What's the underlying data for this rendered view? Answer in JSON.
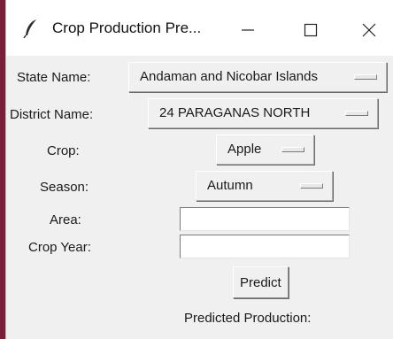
{
  "window": {
    "title": "Crop Production Pre...",
    "icon": "feather-icon",
    "controls": {
      "minimize": "minimize-icon",
      "maximize": "maximize-icon",
      "close": "close-icon"
    }
  },
  "form": {
    "state": {
      "label": "State Name:",
      "value": "Andaman and Nicobar Islands"
    },
    "district": {
      "label": "District Name:",
      "value": "24 PARAGANAS NORTH"
    },
    "crop": {
      "label": "Crop:",
      "value": "Apple"
    },
    "season": {
      "label": "Season:",
      "value": "Autumn"
    },
    "area": {
      "label": "Area:",
      "value": ""
    },
    "crop_year": {
      "label": "Crop Year:",
      "value": ""
    },
    "predict_button": "Predict",
    "result_label": "Predicted Production:"
  }
}
